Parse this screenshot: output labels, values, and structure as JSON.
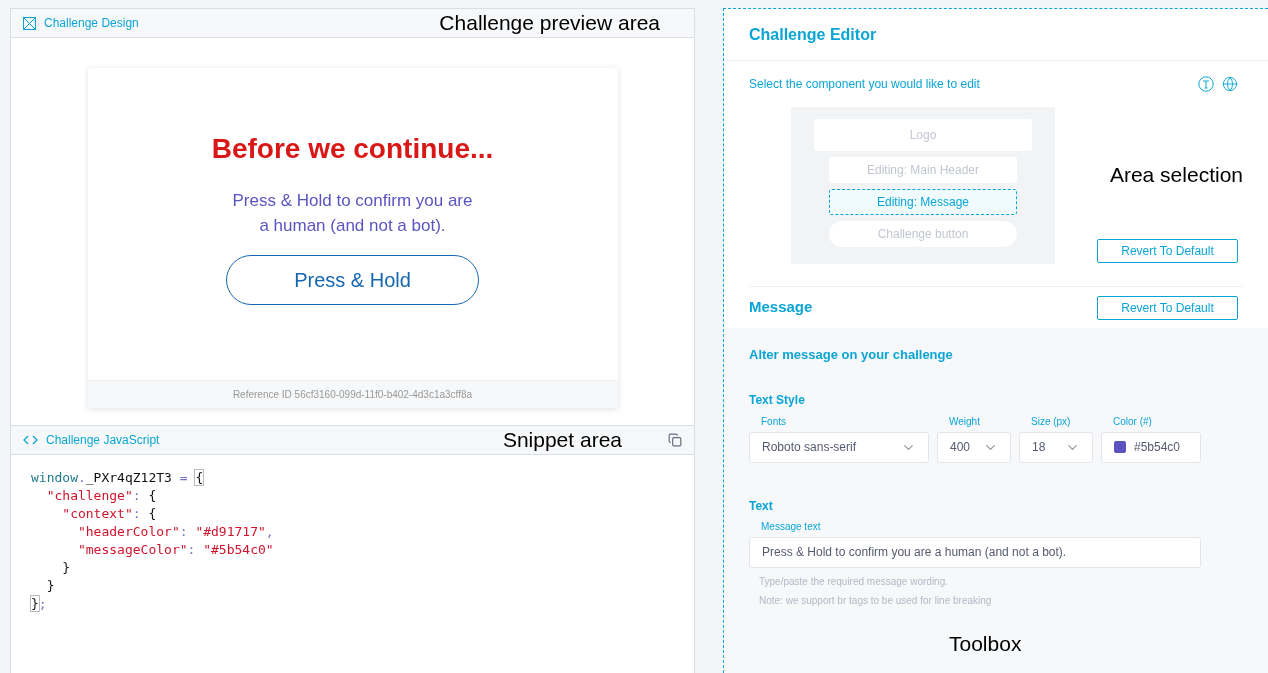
{
  "design_panel": {
    "title": "Challenge Design",
    "annotation": "Challenge preview area",
    "preview": {
      "header": "Before we continue...",
      "message_lines": [
        "Press & Hold to confirm you are",
        "a human (and not a bot)."
      ],
      "button": "Press & Hold",
      "reference": "Reference ID 56cf3160-099d-11f0-b402-4d3c1a3cff8a"
    }
  },
  "snippet_panel": {
    "title": "Challenge JavaScript",
    "annotation": "Snippet area",
    "code_lines": [
      [
        {
          "kind": "ident",
          "text": "window"
        },
        {
          "kind": "punct",
          "text": "."
        },
        {
          "kind": "plain",
          "text": "_PXr4qZ12T3 "
        },
        {
          "kind": "punct",
          "text": "= "
        },
        {
          "kind": "match",
          "text": "{"
        }
      ],
      [
        {
          "kind": "string",
          "text": "  \"challenge\""
        },
        {
          "kind": "punct",
          "text": ": "
        },
        {
          "kind": "plain",
          "text": "{"
        }
      ],
      [
        {
          "kind": "string",
          "text": "    \"context\""
        },
        {
          "kind": "punct",
          "text": ": "
        },
        {
          "kind": "plain",
          "text": "{"
        }
      ],
      [
        {
          "kind": "string",
          "text": "      \"headerColor\""
        },
        {
          "kind": "punct",
          "text": ": "
        },
        {
          "kind": "string",
          "text": "\"#d91717\""
        },
        {
          "kind": "punct",
          "text": ","
        }
      ],
      [
        {
          "kind": "string",
          "text": "      \"messageColor\""
        },
        {
          "kind": "punct",
          "text": ": "
        },
        {
          "kind": "string",
          "text": "\"#5b54c0\""
        }
      ],
      [
        {
          "kind": "plain",
          "text": "    }"
        }
      ],
      [
        {
          "kind": "plain",
          "text": "  }"
        }
      ],
      [
        {
          "kind": "match",
          "text": "}"
        },
        {
          "kind": "punct",
          "text": ";"
        }
      ]
    ]
  },
  "editor": {
    "title": "Challenge Editor",
    "instruction": "Select the component you would like to edit",
    "annotation": "Area selection",
    "components": [
      {
        "kind": "logo",
        "label": "Logo",
        "selected": false
      },
      {
        "kind": "box",
        "label": "Editing: Main Header",
        "selected": false
      },
      {
        "kind": "box",
        "label": "Editing: Message",
        "selected": true
      },
      {
        "kind": "pill",
        "label": "Challenge button",
        "selected": false
      }
    ],
    "revert_button": "Revert To Default",
    "section_title": "Message",
    "section_revert_button": "Revert To Default",
    "subtitle": "Alter message on your challenge",
    "text_style": {
      "heading": "Text Style",
      "fields": [
        {
          "kind": "select",
          "label": "Fonts",
          "value": "Roboto sans-serif"
        },
        {
          "kind": "select",
          "label": "Weight",
          "value": "400"
        },
        {
          "kind": "select",
          "label": "Size (px)",
          "value": "18"
        },
        {
          "kind": "color",
          "label": "Color (#)",
          "value": "#5b54c0"
        }
      ]
    },
    "text": {
      "heading": "Text",
      "label": "Message text",
      "value": "Press & Hold to confirm you are a human (and not a bot).",
      "hints": [
        "Type/paste the required message wording.",
        "Note: we support br tags to be used for line breaking"
      ]
    },
    "annotation_bottom": "Toolbox"
  }
}
